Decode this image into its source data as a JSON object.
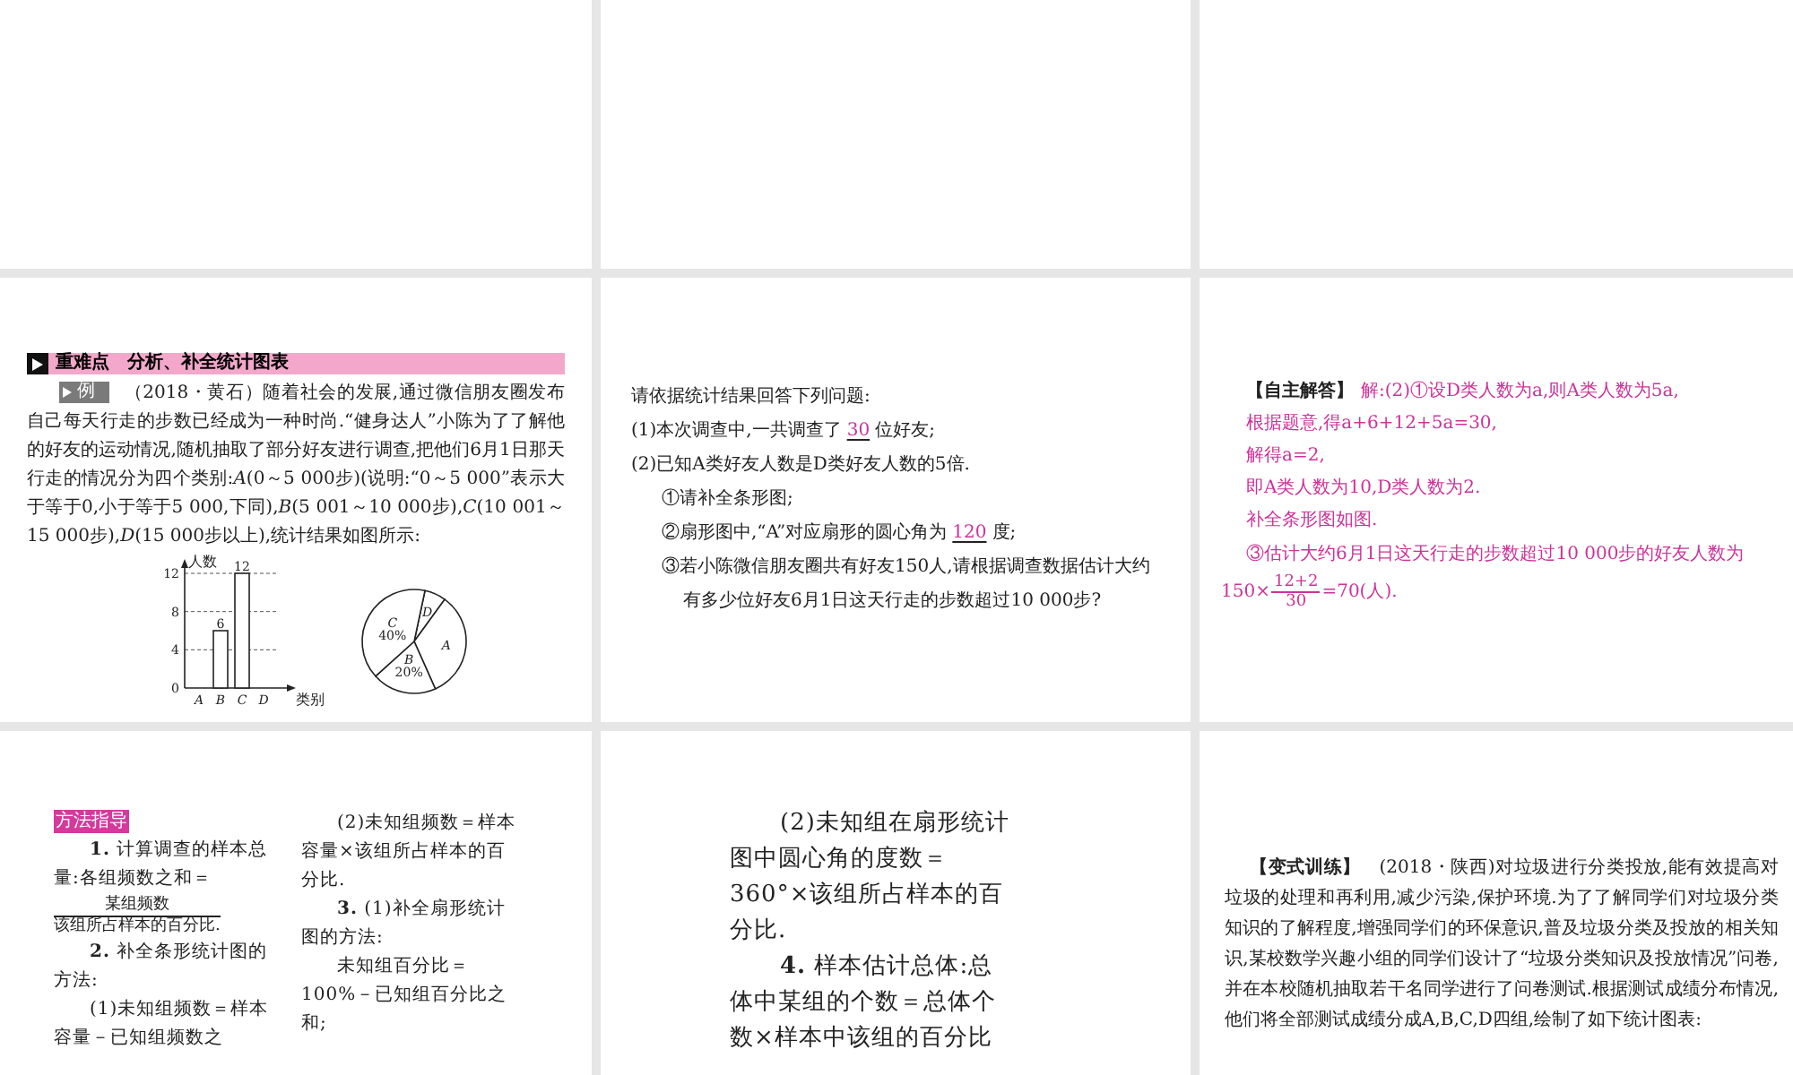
{
  "slides": [
    {
      "kind": "blank"
    },
    {
      "kind": "blank"
    },
    {
      "kind": "blank"
    },
    {
      "kind": "example",
      "section": "重难点　分析、补全统计图表",
      "tag": "例",
      "text": "（2018・黄石）随着社会的发展,通过微信朋友圈发布自己每天行走的步数已经成为一种时尚.“健身达人”小陈为了了解他的好友的运动情况,随机抽取了部分好友进行调查,把他们6月1日那天行走的情况分为四个类别:*A*(0～5 000步)(说明:“0～5 000”表示大于等于0,小于等于5 000,下同),*B*(5 001～10 000步),*C*(10 001～15 000步),*D*(15 000步以上),统计结果如图所示:",
      "chart_data": {
        "type": "bar",
        "ylabel": "人数",
        "xlabel": "类别",
        "categories": [
          "A",
          "B",
          "C",
          "D"
        ],
        "values": [
          null,
          6,
          12,
          null
        ],
        "ylim": [
          0,
          12
        ],
        "yticks": [
          0,
          4,
          8,
          12
        ],
        "data_labels": true
      },
      "pie": [
        {
          "letter": "D"
        },
        {
          "letter": "A"
        },
        {
          "letter": "B",
          "percent": "20%"
        },
        {
          "letter": "C",
          "percent": "40%"
        }
      ]
    },
    {
      "kind": "questions",
      "intro": "请依据统计结果回答下列问题:",
      "items": [
        {
          "text": "(1)本次调查中,一共调查了",
          "answer": "30",
          "after": "位好友;"
        },
        {
          "text": "(2)已知A类好友人数是D类好友人数的5倍.",
          "children": [
            {
              "text": "①请补全条形图;"
            },
            {
              "text": "②扇形图中,“A”对应扇形的圆心角为",
              "answer": "120",
              "after": "度;"
            },
            {
              "text": "③若小陈微信朋友圈共有好友150人,请根据调查数据估计大约有多少位好友6月1日这天行走的步数超过10 000步?"
            }
          ]
        }
      ]
    },
    {
      "kind": "answer",
      "label": "【自主解答】",
      "lines": [
        "解:(2)①设D类人数为a,则A类人数为5a,",
        "根据题意,得a+6+12+5a=30,",
        "解得a=2,",
        "即A类人数为10,D类人数为2.",
        "补全条形图如图."
      ],
      "last": {
        "text": "③估计大约6月1日这天行走的步数超过10 000步的好友人数为150×",
        "numerator": "12+2",
        "denominator": "30",
        "after": "=70(人)."
      }
    },
    {
      "kind": "method",
      "badge": "方法指导",
      "columns": [
        [
          {
            "kind": "para",
            "text": "**1.** 计算调查的样本总量:各组频数之和＝"
          },
          {
            "kind": "fraction",
            "numerator": "某组频数",
            "denominator": "该组所占样本的百分比."
          },
          {
            "kind": "para",
            "text": "**2.** 补全条形统计图的方法:"
          },
          {
            "kind": "para",
            "text": "(1)未知组频数＝样本容量－已知组频数之"
          }
        ],
        [
          {
            "kind": "para",
            "text": "(2)未知组频数＝样本容量×该组所占样本的百分比."
          },
          {
            "kind": "para",
            "text": "**3.** (1)补全扇形统计图的方法:"
          },
          {
            "kind": "para",
            "text": "未知组百分比＝100%－已知组百分比之和;"
          }
        ]
      ]
    },
    {
      "kind": "text_column",
      "paragraphs": [
        "(2)未知组在扇形统计图中圆心角的度数＝360°×该组所占样本的百分比.",
        "**4.** 样本估计总体:总体中某组的个数＝总体个数×样本中该组的百分比"
      ]
    },
    {
      "kind": "exercise",
      "text": "**【变式训练】**　(2018・陕西)对垃圾进行分类投放,能有效提高对垃圾的处理和再利用,减少污染,保护环境.为了了解同学们对垃圾分类知识的了解程度,增强同学们的环保意识,普及垃圾分类及投放的相关知识,某校数学兴趣小组的同学们设计了“垃圾分类知识及投放情况”问卷,并在本校随机抽取若干名同学进行了问卷测试.根据测试成绩分布情况,他们将全部测试成绩分成A,B,C,D四组,绘制了如下统计图表:"
    }
  ]
}
